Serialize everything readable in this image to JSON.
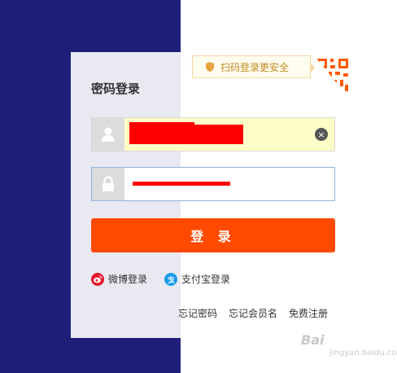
{
  "title": "密码登录",
  "qr_tip": "扫码登录更安全",
  "username": {
    "value": "",
    "placeholder": ""
  },
  "password": {
    "value": "",
    "placeholder": ""
  },
  "login_button": "登 录",
  "alt_logins": [
    {
      "label": "微博登录",
      "icon": "weibo-icon",
      "color": "#e6162d"
    },
    {
      "label": "支付宝登录",
      "icon": "alipay-icon",
      "color": "#1b9bea"
    }
  ],
  "links": [
    "忘记密码",
    "忘记会员名",
    "免费注册"
  ],
  "watermark": {
    "brand": "Bai",
    "domain": "jingyan.baidu.com"
  },
  "colors": {
    "accent": "#ff4a00",
    "background_left": "#1f1f7a",
    "tip_text": "#c18a22",
    "redaction": "#ff0000"
  }
}
